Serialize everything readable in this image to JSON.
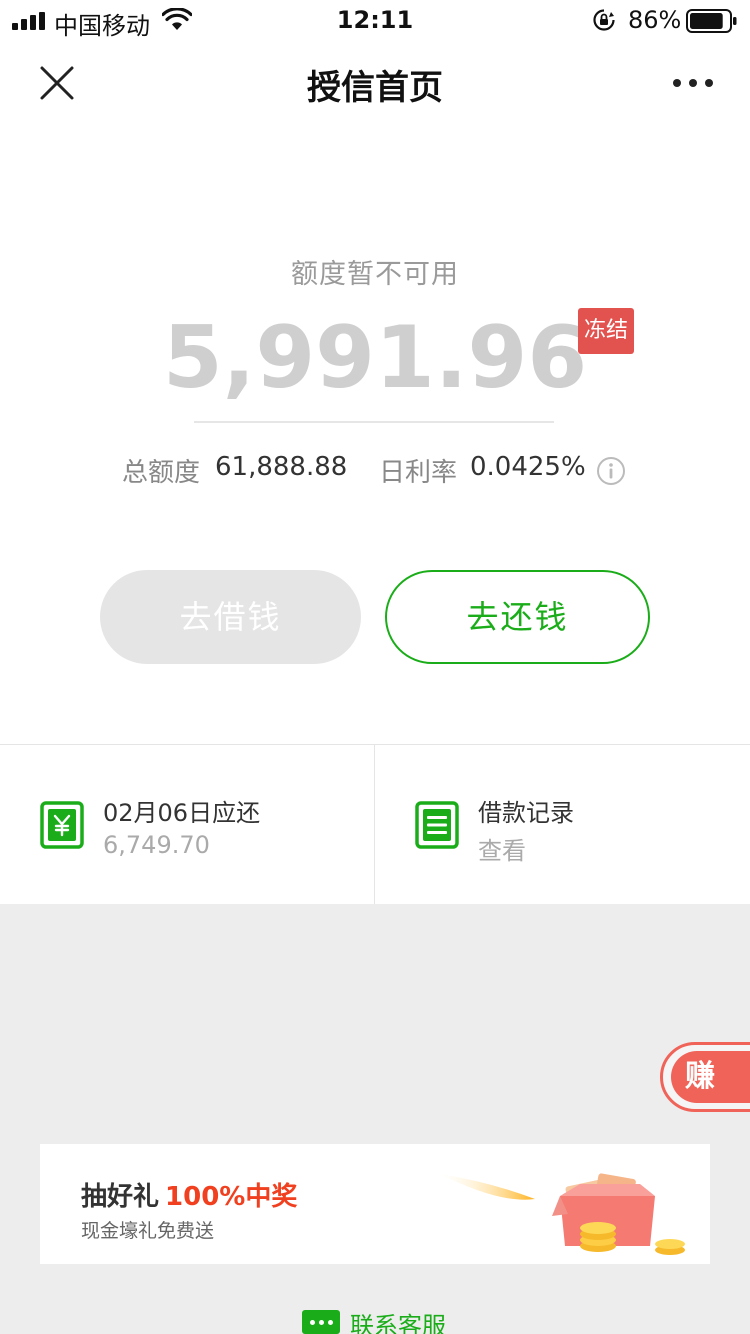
{
  "status_bar": {
    "carrier": "中国移动",
    "time": "12:11",
    "battery_percent": "86%",
    "battery_level": 0.86
  },
  "nav": {
    "title": "授信首页",
    "close_icon": "close-icon",
    "more_icon": "more-icon"
  },
  "credit": {
    "status_label": "额度暂不可用",
    "available_amount": "5,991.96",
    "frozen_badge": "冻结",
    "total_label": "总额度",
    "total_value": "61,888.88",
    "rate_label": "日利率",
    "rate_value": "0.0425%"
  },
  "actions": {
    "borrow_label": "去借钱",
    "repay_label": "去还钱"
  },
  "tiles": [
    {
      "title": "02月06日应还",
      "subtitle": "6,749.70",
      "icon": "yuan-icon"
    },
    {
      "title": "借款记录",
      "subtitle": "查看",
      "icon": "list-icon"
    }
  ],
  "reward": {
    "label": "赚奖"
  },
  "banner": {
    "title": "抽好礼",
    "highlight": "100%中奖",
    "subtitle": "现金壕礼免费送"
  },
  "contact": {
    "label": "联系客服"
  },
  "colors": {
    "accent_green": "#1aad19",
    "frozen_red": "#e2534f",
    "highlight_red": "#f0401f"
  }
}
